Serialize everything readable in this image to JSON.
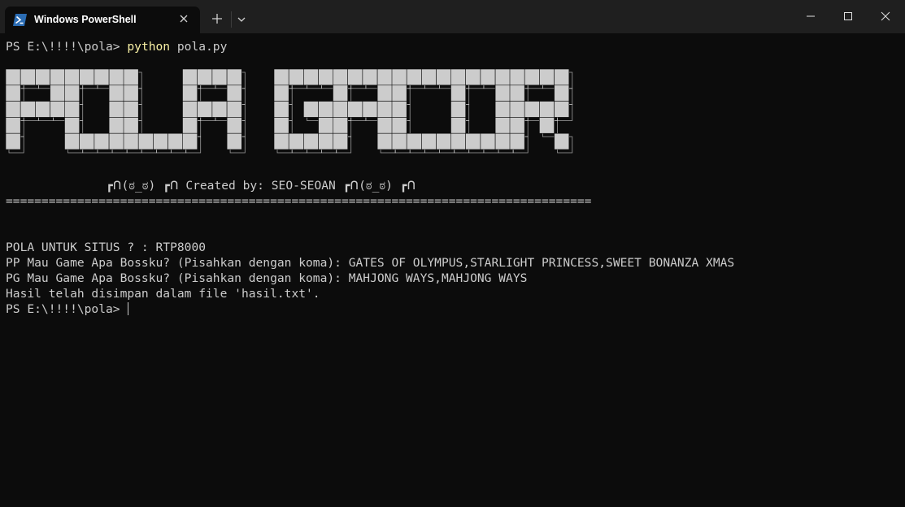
{
  "window": {
    "tab_title": "Windows PowerShell",
    "icons": {
      "tab": "powershell-icon",
      "close": "close-icon",
      "new_tab": "plus-icon",
      "dropdown": "chevron-down-icon",
      "minimize": "minimize-icon",
      "maximize": "maximize-icon",
      "close_window": "close-window-icon"
    }
  },
  "terminal": {
    "prompt1": "PS E:\\!!!!\\pola> ",
    "cmd_name": "python",
    "cmd_args": " pola.py",
    "banner_text": "POLA GACOR",
    "banner_color": "#cccccc",
    "created_line": "              ┏ᑎ(ಠ_ಠ) ┏ᑎ Created by: SEO-SEOAN ┏ᑎ(ಠ_ಠ) ┏ᑎ",
    "separator": "==================================================================================",
    "q1": "POLA UNTUK SITUS ? : RTP8000",
    "q2": "PP Mau Game Apa Bossku? (Pisahkan dengan koma): GATES OF OLYMPUS,STARLIGHT PRINCESS,SWEET BONANZA XMAS",
    "q3": "PG Mau Game Apa Bossku? (Pisahkan dengan koma): MAHJONG WAYS,MAHJONG WAYS",
    "result": "Hasil telah disimpan dalam file 'hasil.txt'.",
    "prompt2": "PS E:\\!!!!\\pola> "
  },
  "colors": {
    "background": "#0c0c0c",
    "titlebar": "#1f1f1f",
    "text": "#cccccc",
    "command": "#f9f1a5",
    "ps_icon": "#2b5797"
  }
}
